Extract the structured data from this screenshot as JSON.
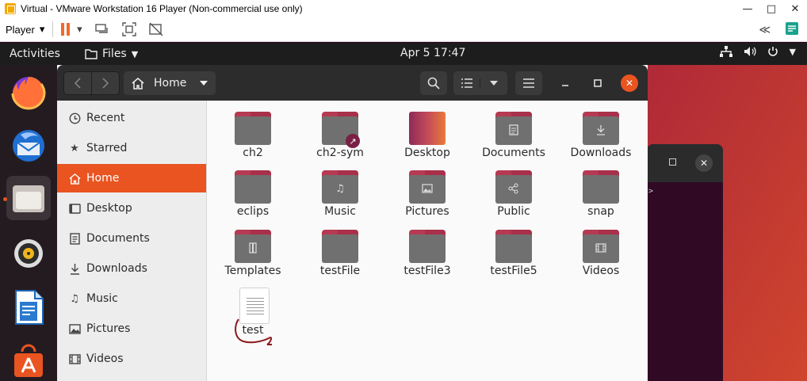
{
  "vmware": {
    "title": "Virtual - VMware Workstation 16 Player (Non-commercial use only)",
    "player_menu": "Player",
    "window_controls": [
      "—",
      "□",
      "✕"
    ]
  },
  "topbar": {
    "activities": "Activities",
    "app_menu": "Files",
    "clock": "Apr 5  17:47"
  },
  "dock": {
    "apps": [
      "firefox",
      "thunderbird",
      "files",
      "rhythmbox",
      "libreoffice-writer",
      "ubuntu-software"
    ]
  },
  "files_window": {
    "location": "Home",
    "sidebar": [
      {
        "label": "Recent",
        "icon": "clock-icon"
      },
      {
        "label": "Starred",
        "icon": "star-icon"
      },
      {
        "label": "Home",
        "icon": "home-icon",
        "selected": true
      },
      {
        "label": "Desktop",
        "icon": "desktop-icon"
      },
      {
        "label": "Documents",
        "icon": "document-icon"
      },
      {
        "label": "Downloads",
        "icon": "download-icon"
      },
      {
        "label": "Music",
        "icon": "music-icon"
      },
      {
        "label": "Pictures",
        "icon": "picture-icon"
      },
      {
        "label": "Videos",
        "icon": "video-icon"
      }
    ],
    "items": [
      {
        "label": "ch2",
        "kind": "folder"
      },
      {
        "label": "ch2-sym",
        "kind": "folder-symlink"
      },
      {
        "label": "Desktop",
        "kind": "folder-desktop"
      },
      {
        "label": "Documents",
        "kind": "folder-documents"
      },
      {
        "label": "Downloads",
        "kind": "folder-downloads"
      },
      {
        "label": "eclips",
        "kind": "folder"
      },
      {
        "label": "Music",
        "kind": "folder-music"
      },
      {
        "label": "Pictures",
        "kind": "folder-pictures"
      },
      {
        "label": "Public",
        "kind": "folder-public"
      },
      {
        "label": "snap",
        "kind": "folder"
      },
      {
        "label": "Templates",
        "kind": "folder-templates"
      },
      {
        "label": "testFile",
        "kind": "folder"
      },
      {
        "label": "testFile3",
        "kind": "folder"
      },
      {
        "label": "testFile5",
        "kind": "folder"
      },
      {
        "label": "Videos",
        "kind": "folder-videos"
      },
      {
        "label": "test",
        "kind": "text-file"
      }
    ]
  },
  "colors": {
    "accent": "#e95420",
    "folder_tab": "#b53a52",
    "folder_body": "#707070",
    "headerbar": "#2c2c2c"
  }
}
